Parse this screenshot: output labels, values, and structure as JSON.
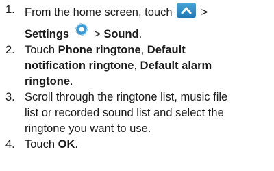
{
  "steps": [
    {
      "num": "1.",
      "line1_text": "From the home screen, touch",
      "line1_sep": ">",
      "settings": "Settings",
      "sep": ">",
      "sound": "Sound",
      "end": "."
    },
    {
      "num": "2.",
      "t1": "Touch ",
      "b1": "Phone ringtone",
      "t2": ", ",
      "b2": "Default",
      "b3": "notification ringtone",
      "t3": ", ",
      "b4": "Default alarm",
      "b5": "ringtone",
      "t4": "."
    },
    {
      "num": "3.",
      "l1": "Scroll through the ringtone list, music file",
      "l2": "list or recorded sound list and select the",
      "l3": "ringtone you want to use."
    },
    {
      "num": "4.",
      "t1": "Touch ",
      "b1": "OK",
      "t2": "."
    }
  ],
  "icons": {
    "apps_icon": "chevron-up-icon",
    "settings_icon": "settings-gear-icon"
  }
}
